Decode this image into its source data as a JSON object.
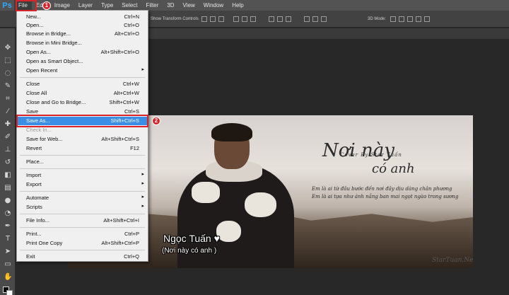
{
  "app": {
    "logo": "Ps"
  },
  "menubar": {
    "items": [
      "File",
      "Edit",
      "Image",
      "Layer",
      "Type",
      "Select",
      "Filter",
      "3D",
      "View",
      "Window",
      "Help"
    ]
  },
  "optionsbar": {
    "show_transform": "Show Transform Controls",
    "mode_3d": "3D Mode:"
  },
  "file_menu": {
    "items": [
      {
        "label": "New...",
        "shortcut": "Ctrl+N"
      },
      {
        "label": "Open...",
        "shortcut": "Ctrl+O"
      },
      {
        "label": "Browse in Bridge...",
        "shortcut": "Alt+Ctrl+O"
      },
      {
        "label": "Browse in Mini Bridge...",
        "shortcut": ""
      },
      {
        "label": "Open As...",
        "shortcut": "Alt+Shift+Ctrl+O"
      },
      {
        "label": "Open as Smart Object...",
        "shortcut": ""
      },
      {
        "label": "Open Recent",
        "shortcut": ""
      },
      {
        "label": "Close",
        "shortcut": "Ctrl+W"
      },
      {
        "label": "Close All",
        "shortcut": "Alt+Ctrl+W"
      },
      {
        "label": "Close and Go to Bridge...",
        "shortcut": "Shift+Ctrl+W"
      },
      {
        "label": "Save",
        "shortcut": "Ctrl+S"
      },
      {
        "label": "Save As...",
        "shortcut": "Shift+Ctrl+S"
      },
      {
        "label": "Check In...",
        "shortcut": ""
      },
      {
        "label": "Save for Web...",
        "shortcut": "Alt+Shift+Ctrl+S"
      },
      {
        "label": "Revert",
        "shortcut": "F12"
      },
      {
        "label": "Place...",
        "shortcut": ""
      },
      {
        "label": "Import",
        "shortcut": ""
      },
      {
        "label": "Export",
        "shortcut": ""
      },
      {
        "label": "Automate",
        "shortcut": ""
      },
      {
        "label": "Scripts",
        "shortcut": ""
      },
      {
        "label": "File Info...",
        "shortcut": "Alt+Shift+Ctrl+I"
      },
      {
        "label": "Print...",
        "shortcut": "Ctrl+P"
      },
      {
        "label": "Print One Copy",
        "shortcut": "Alt+Shift+Ctrl+P"
      },
      {
        "label": "Exit",
        "shortcut": "Ctrl+Q"
      }
    ]
  },
  "annotations": {
    "step1": "1",
    "step2": "2"
  },
  "canvas": {
    "title_line1": "Nơi này",
    "title_line2": "có anh",
    "cover": "Cover By Star Tuấn",
    "lyric1": "Em là ai từ đâu bước đến nơi đây dịu dàng chân phương",
    "lyric2": "Em là ai tựa như ánh nắng ban mai ngọt ngào trong sương",
    "name_line1": "Ngọc Tuấn ♥",
    "name_line2": "(Nơi này có anh )",
    "watermark": "StarTuan.Net"
  },
  "colors": {
    "highlight": "#3a8ee6",
    "annotation_red": "#d9232a",
    "menu_bg": "#f0f0f0"
  }
}
